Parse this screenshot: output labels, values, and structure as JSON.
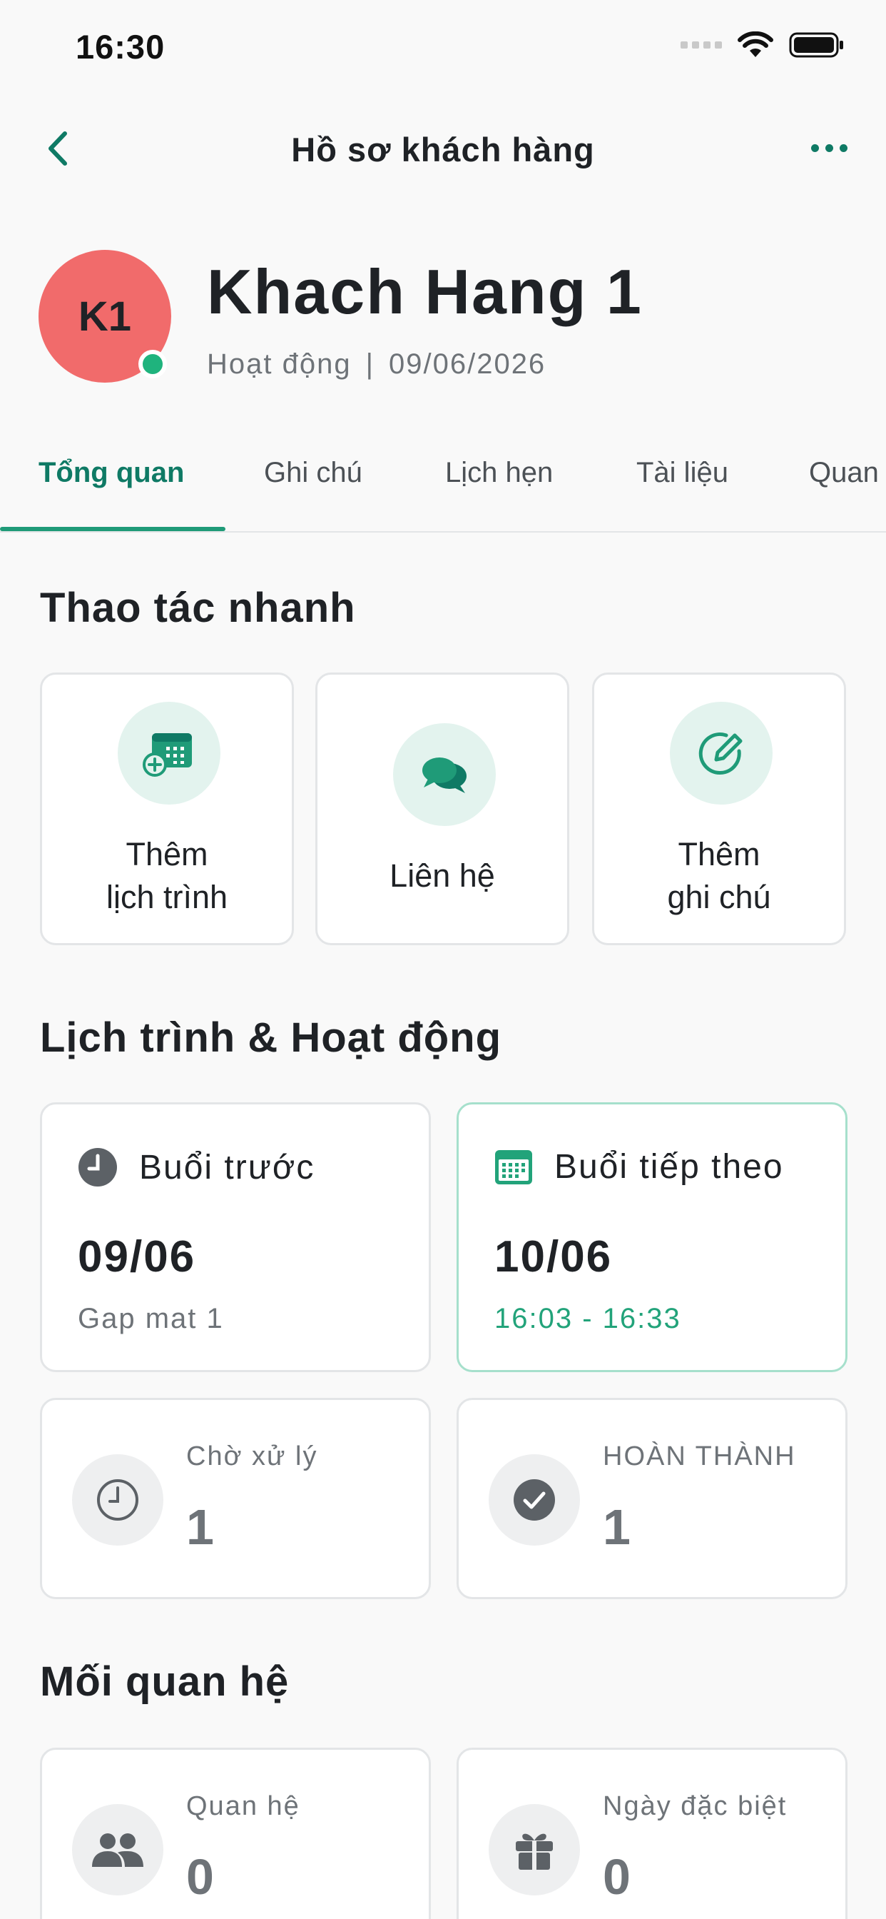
{
  "status_bar": {
    "time": "16:30"
  },
  "nav": {
    "title": "Hồ sơ khách hàng"
  },
  "profile": {
    "initials": "K1",
    "name": "Khach Hang 1",
    "status": "Hoạt động",
    "separator": "|",
    "date": "09/06/2026",
    "avatar_color": "#f16b6b",
    "online_color": "#1fb37d"
  },
  "tabs": [
    {
      "label": "Tổng quan",
      "active": true
    },
    {
      "label": "Ghi chú",
      "active": false
    },
    {
      "label": "Lịch hẹn",
      "active": false
    },
    {
      "label": "Tài liệu",
      "active": false
    },
    {
      "label": "Quan",
      "active": false
    }
  ],
  "quick_actions": {
    "title": "Thao tác nhanh",
    "items": [
      {
        "line1": "Thêm",
        "line2": "lịch trình",
        "icon": "calendar-add-icon"
      },
      {
        "line1": "Liên hệ",
        "line2": "",
        "icon": "chat-bubbles-icon"
      },
      {
        "line1": "Thêm",
        "line2": "ghi chú",
        "icon": "edit-note-icon"
      }
    ]
  },
  "schedule": {
    "title": "Lịch trình & Hoạt động",
    "previous": {
      "label": "Buổi trước",
      "date": "09/06",
      "subtitle": "Gap mat 1"
    },
    "next": {
      "label": "Buổi tiếp theo",
      "date": "10/06",
      "time": "16:03 - 16:33"
    },
    "pending": {
      "label": "Chờ xử lý",
      "value": "1"
    },
    "completed": {
      "label": "HOÀN THÀNH",
      "value": "1"
    }
  },
  "relations": {
    "title": "Mối quan hệ",
    "relation": {
      "label": "Quan hệ",
      "value": "0"
    },
    "special_days": {
      "label": "Ngày đặc biệt",
      "value": "0"
    }
  },
  "colors": {
    "accent": "#0f7a65",
    "accent_light": "#e3f3ee",
    "time_green": "#22a37a"
  }
}
